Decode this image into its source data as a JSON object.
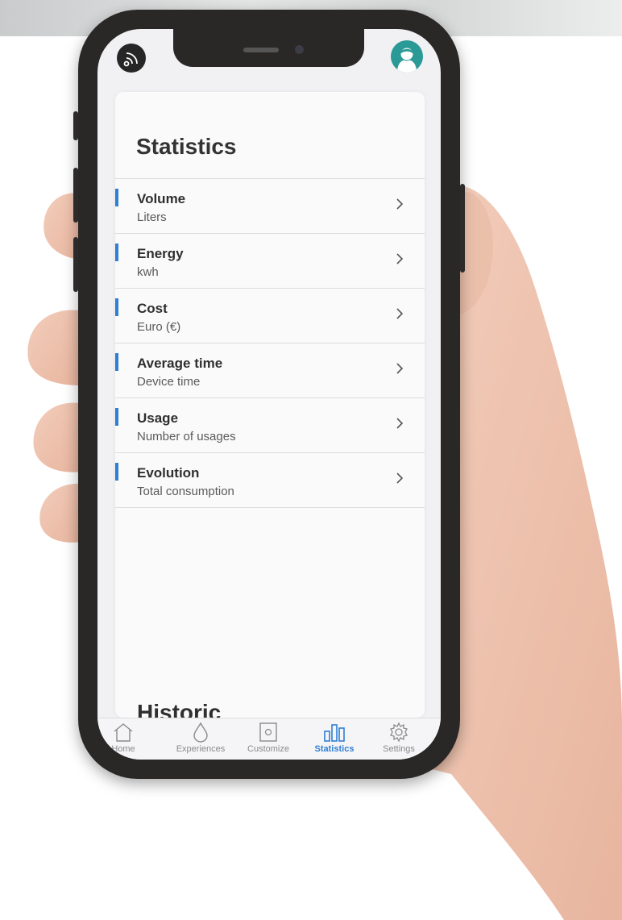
{
  "screen": {
    "title": "Statistics",
    "next_section_title": "Historic",
    "accent_color": "#2f7fd2"
  },
  "statistics": [
    {
      "label": "Volume",
      "sub": "Liters"
    },
    {
      "label": "Energy",
      "sub": "kwh"
    },
    {
      "label": "Cost",
      "sub": "Euro (€)"
    },
    {
      "label": "Average time",
      "sub": "Device time"
    },
    {
      "label": "Usage",
      "sub": "Number of usages"
    },
    {
      "label": "Evolution",
      "sub": "Total consumption"
    }
  ],
  "tabs": [
    {
      "label": "Home",
      "icon": "home-icon"
    },
    {
      "label": "Experiences",
      "icon": "drop-icon"
    },
    {
      "label": "Customize",
      "icon": "device-icon"
    },
    {
      "label": "Statistics",
      "icon": "bar-chart-icon",
      "active": true
    },
    {
      "label": "Settings",
      "icon": "gear-icon"
    }
  ],
  "header_icons": {
    "left": "wifi-icon",
    "right": "avatar"
  }
}
